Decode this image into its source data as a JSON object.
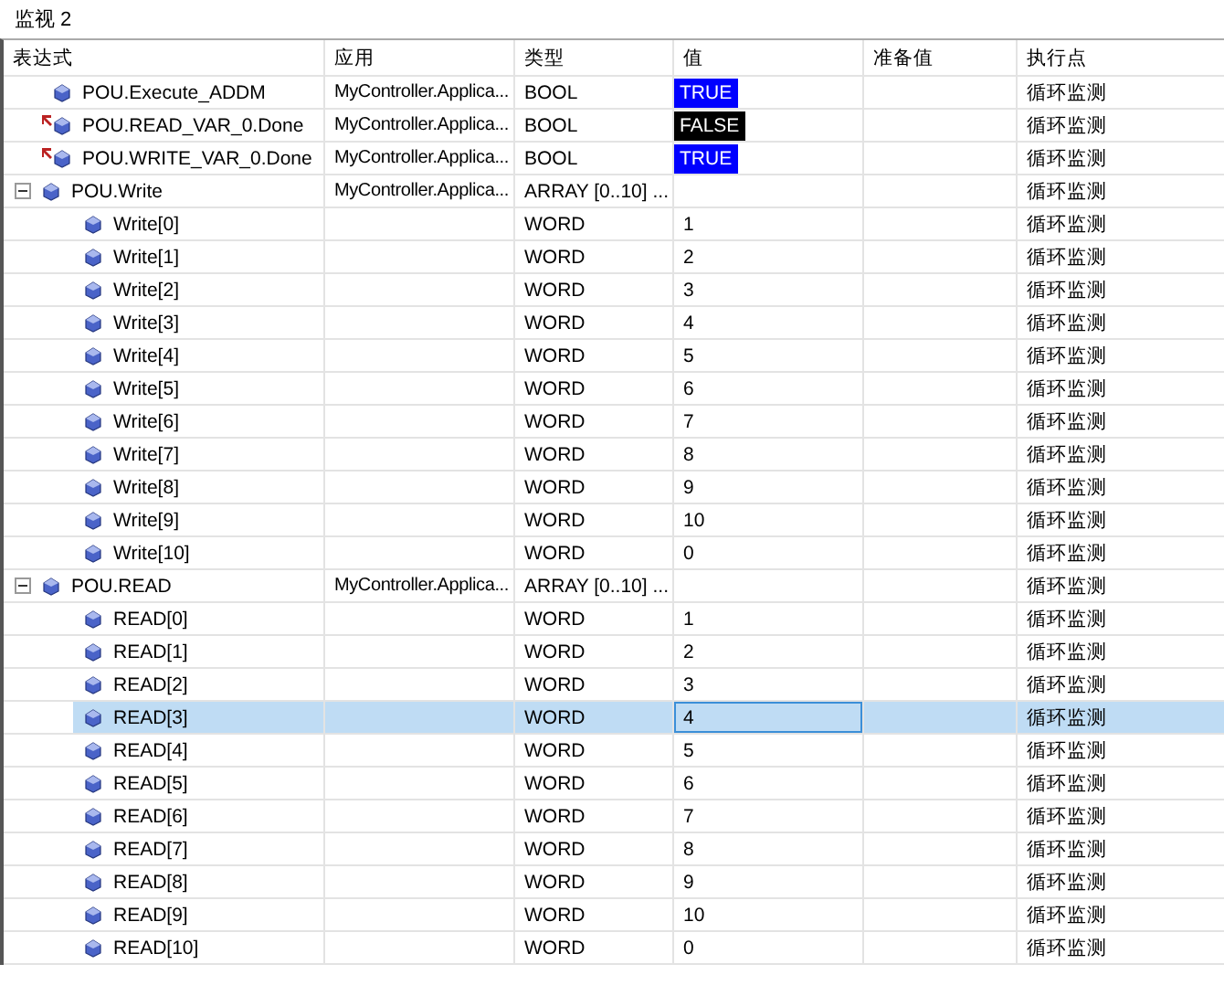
{
  "window": {
    "title": "监视 2"
  },
  "table": {
    "columns": [
      "表达式",
      "应用",
      "类型",
      "值",
      "准备值",
      "执行点"
    ],
    "rows": [
      {
        "expression": "POU.Execute_ADDM",
        "application": "MyController.Applica...",
        "type": "BOOL",
        "value": "TRUE",
        "color": "#0000ff",
        "forced": false,
        "selected": false,
        "execution_point": "循环监测"
      },
      {
        "expression": "POU.READ_VAR_0.Done",
        "application": "MyController.Applica...",
        "type": "BOOL",
        "value": "FALSE",
        "color": "#000000",
        "forced": true,
        "selected": false,
        "execution_point": "循环监测"
      },
      {
        "expression": "POU.WRITE_VAR_0.Done",
        "application": "MyController.Applica...",
        "type": "BOOL",
        "value": "TRUE",
        "color": "#0000ff",
        "forced": true,
        "selected": false,
        "execution_point": "循环监测"
      },
      {
        "expression": "POU.Write",
        "application": "MyController.Applica...",
        "type": "ARRAY [0..10] ...",
        "expanded": true,
        "selected": false,
        "execution_point": "循环监测",
        "children": [
          {
            "expression": "Write[0]",
            "type": "WORD",
            "value": "1",
            "selected": false,
            "execution_point": "循环监测"
          },
          {
            "expression": "Write[1]",
            "type": "WORD",
            "value": "2",
            "selected": false,
            "execution_point": "循环监测"
          },
          {
            "expression": "Write[2]",
            "type": "WORD",
            "value": "3",
            "selected": false,
            "execution_point": "循环监测"
          },
          {
            "expression": "Write[3]",
            "type": "WORD",
            "value": "4",
            "selected": false,
            "execution_point": "循环监测"
          },
          {
            "expression": "Write[4]",
            "type": "WORD",
            "value": "5",
            "selected": false,
            "execution_point": "循环监测"
          },
          {
            "expression": "Write[5]",
            "type": "WORD",
            "value": "6",
            "selected": false,
            "execution_point": "循环监测"
          },
          {
            "expression": "Write[6]",
            "type": "WORD",
            "value": "7",
            "selected": false,
            "execution_point": "循环监测"
          },
          {
            "expression": "Write[7]",
            "type": "WORD",
            "value": "8",
            "selected": false,
            "execution_point": "循环监测"
          },
          {
            "expression": "Write[8]",
            "type": "WORD",
            "value": "9",
            "selected": false,
            "execution_point": "循环监测"
          },
          {
            "expression": "Write[9]",
            "type": "WORD",
            "value": "10",
            "selected": false,
            "execution_point": "循环监测"
          },
          {
            "expression": "Write[10]",
            "type": "WORD",
            "value": "0",
            "selected": false,
            "execution_point": "循环监测"
          }
        ]
      },
      {
        "expression": "POU.READ",
        "application": "MyController.Applica...",
        "type": "ARRAY [0..10] ...",
        "expanded": true,
        "selected": false,
        "execution_point": "循环监测",
        "children": [
          {
            "expression": "READ[0]",
            "type": "WORD",
            "value": "1",
            "selected": false,
            "execution_point": "循环监测"
          },
          {
            "expression": "READ[1]",
            "type": "WORD",
            "value": "2",
            "selected": false,
            "execution_point": "循环监测"
          },
          {
            "expression": "READ[2]",
            "type": "WORD",
            "value": "3",
            "selected": false,
            "execution_point": "循环监测"
          },
          {
            "expression": "READ[3]",
            "type": "WORD",
            "value": "4",
            "selected": true,
            "execution_point": "循环监测"
          },
          {
            "expression": "READ[4]",
            "type": "WORD",
            "value": "5",
            "selected": false,
            "execution_point": "循环监测"
          },
          {
            "expression": "READ[5]",
            "type": "WORD",
            "value": "6",
            "selected": false,
            "execution_point": "循环监测"
          },
          {
            "expression": "READ[6]",
            "type": "WORD",
            "value": "7",
            "selected": false,
            "execution_point": "循环监测"
          },
          {
            "expression": "READ[7]",
            "type": "WORD",
            "value": "8",
            "selected": false,
            "execution_point": "循环监测"
          },
          {
            "expression": "READ[8]",
            "type": "WORD",
            "value": "9",
            "selected": false,
            "execution_point": "循环监测"
          },
          {
            "expression": "READ[9]",
            "type": "WORD",
            "value": "10",
            "selected": false,
            "execution_point": "循环监测"
          },
          {
            "expression": "READ[10]",
            "type": "WORD",
            "value": "0",
            "selected": false,
            "execution_point": "循环监测"
          }
        ]
      }
    ]
  }
}
